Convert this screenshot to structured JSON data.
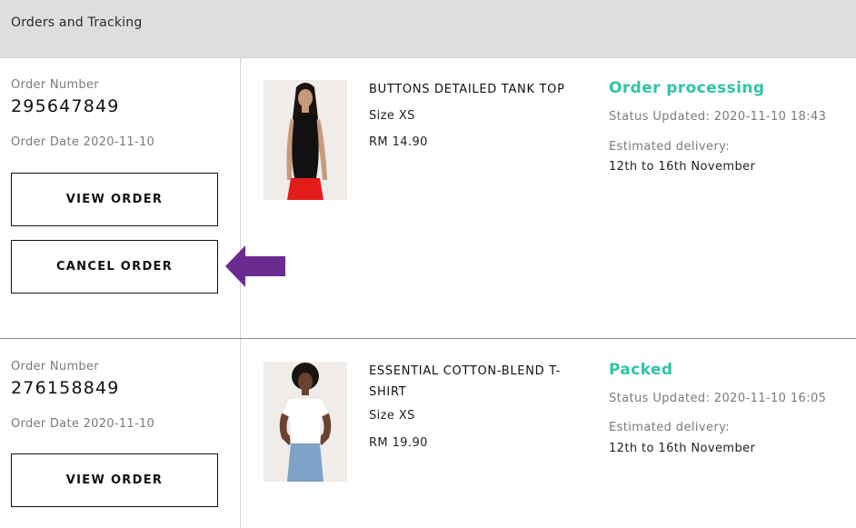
{
  "header": {
    "title": "Orders and Tracking"
  },
  "colors": {
    "status": "#2ec4a6",
    "arrow": "#6b2c91"
  },
  "orders": [
    {
      "number_label": "Order Number",
      "number": "295647849",
      "date": "Order Date 2020-11-10",
      "view_label": "VIEW ORDER",
      "cancel_label": "CANCEL ORDER",
      "product": {
        "name": "BUTTONS DETAILED TANK TOP",
        "size": "Size XS",
        "price": "RM 14.90",
        "image_icon": "black-tank-top-model-photo"
      },
      "status": "Order processing",
      "updated": "Status Updated: 2020-11-10 18:43",
      "est_label": "Estimated delivery:",
      "est_value": "12th to 16th November"
    },
    {
      "number_label": "Order Number",
      "number": "276158849",
      "date": "Order Date 2020-11-10",
      "view_label": "VIEW ORDER",
      "product": {
        "name": "ESSENTIAL COTTON-BLEND T-SHIRT",
        "size": "Size XS",
        "price": "RM 19.90",
        "image_icon": "white-tshirt-model-photo"
      },
      "status": "Packed",
      "updated": "Status Updated: 2020-11-10 16:05",
      "est_label": "Estimated delivery:",
      "est_value": "12th to 16th November"
    }
  ]
}
